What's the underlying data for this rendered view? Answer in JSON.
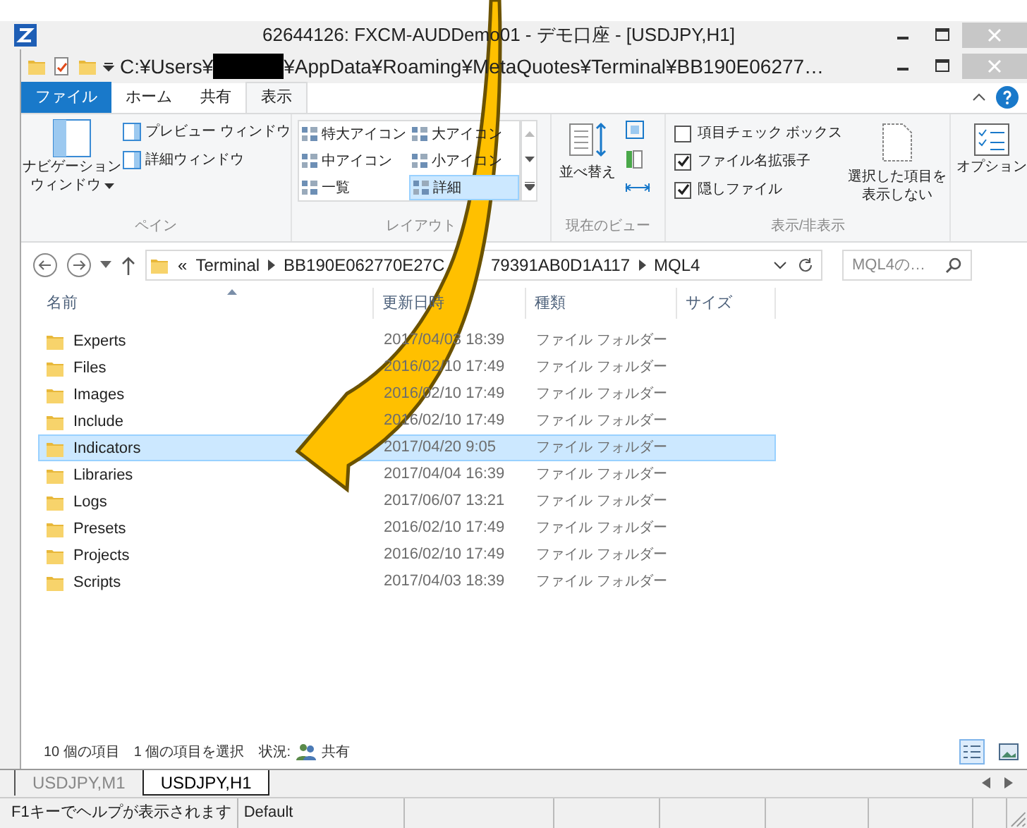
{
  "app_window": {
    "title": "62644126: FXCM-AUDDemo01 - デモ口座 - [USDJPY,H1]"
  },
  "explorer": {
    "path_start": "C:¥Users¥",
    "path_end": "¥AppData¥Roaming¥MetaQuotes¥Terminal¥BB190E06277…",
    "ribbon_tabs": [
      {
        "label": "ファイル",
        "kind": "file",
        "selected": false
      },
      {
        "label": "ホーム",
        "kind": "tab",
        "selected": false
      },
      {
        "label": "共有",
        "kind": "tab",
        "selected": false
      },
      {
        "label": "表示",
        "kind": "tab",
        "selected": true
      }
    ],
    "ribbon": {
      "pane": {
        "nav_lines": [
          "ナビゲーション",
          "ウィンドウ"
        ],
        "items": [
          "プレビュー ウィンドウ",
          "詳細ウィンドウ"
        ],
        "group_label": "ペイン"
      },
      "layout": {
        "options": [
          {
            "label": "特大アイコン",
            "selected": false
          },
          {
            "label": "大アイコン",
            "selected": false
          },
          {
            "label": "中アイコン",
            "selected": false
          },
          {
            "label": "小アイコン",
            "selected": false
          },
          {
            "label": "一覧",
            "selected": false
          },
          {
            "label": "詳細",
            "selected": true
          }
        ],
        "group_label": "レイアウト"
      },
      "current_view": {
        "sort_button": "並べ替え",
        "group_label": "現在のビュー"
      },
      "show_hide": {
        "checkboxes": [
          {
            "label": "項目チェック ボックス",
            "checked": false
          },
          {
            "label": "ファイル名拡張子",
            "checked": true
          },
          {
            "label": "隠しファイル",
            "checked": true
          }
        ],
        "hide_lines": [
          "選択した項目を",
          "表示しない"
        ],
        "group_label": "表示/非表示"
      },
      "options_button": "オプション"
    },
    "address": {
      "crumbs": [
        "«",
        "Terminal"
      ],
      "crumb_head": "BB190E062770E27C",
      "crumb_tail": "79391AB0D1A117",
      "current": "MQL4",
      "search_placeholder": "MQL4の…"
    },
    "columns": [
      "名前",
      "更新日時",
      "種類",
      "サイズ"
    ],
    "rows": [
      {
        "name": "Experts",
        "date": "2017/04/03 18:39",
        "type": "ファイル フォルダー",
        "selected": false
      },
      {
        "name": "Files",
        "date": "2016/02/10 17:49",
        "type": "ファイル フォルダー",
        "selected": false
      },
      {
        "name": "Images",
        "date": "2016/02/10 17:49",
        "type": "ファイル フォルダー",
        "selected": false
      },
      {
        "name": "Include",
        "date": "2016/02/10 17:49",
        "type": "ファイル フォルダー",
        "selected": false
      },
      {
        "name": "Indicators",
        "date": "2017/04/20 9:05",
        "type": "ファイル フォルダー",
        "selected": true
      },
      {
        "name": "Libraries",
        "date": "2017/04/04 16:39",
        "type": "ファイル フォルダー",
        "selected": false
      },
      {
        "name": "Logs",
        "date": "2017/06/07 13:21",
        "type": "ファイル フォルダー",
        "selected": false
      },
      {
        "name": "Presets",
        "date": "2016/02/10 17:49",
        "type": "ファイル フォルダー",
        "selected": false
      },
      {
        "name": "Projects",
        "date": "2016/02/10 17:49",
        "type": "ファイル フォルダー",
        "selected": false
      },
      {
        "name": "Scripts",
        "date": "2017/04/03 18:39",
        "type": "ファイル フォルダー",
        "selected": false
      }
    ],
    "status": {
      "count": "10 個の項目",
      "selection": "1 個の項目を選択",
      "state_label": "状況:",
      "state_value": "共有"
    }
  },
  "chart_tabs": [
    {
      "label": "USDJPY,M1",
      "selected": false
    },
    {
      "label": "USDJPY,H1",
      "selected": true
    }
  ],
  "status_bar": [
    "F1キーでヘルプが表示されます",
    "Default"
  ]
}
